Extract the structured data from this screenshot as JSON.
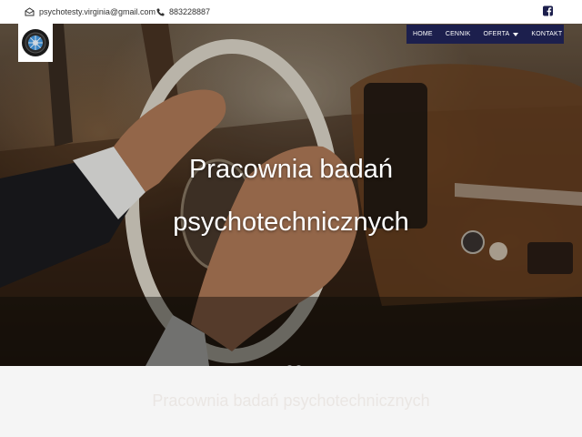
{
  "topbar": {
    "email": "psychotesty.virginia@gmail.com",
    "phone": "883228887"
  },
  "nav": {
    "items": [
      {
        "label": "HOME"
      },
      {
        "label": "CENNIK"
      },
      {
        "label": "OFERTA",
        "has_dropdown": true
      },
      {
        "label": "KONTAKT"
      }
    ]
  },
  "hero": {
    "title_line1": "Pracownia badań",
    "title_line2": "psychotechnicznych",
    "slides_count": 2,
    "active_slide": 1
  },
  "section": {
    "title": "Pracownia badań psychotechnicznych"
  },
  "colors": {
    "nav_bg": "#1c1f4d",
    "topbar_bg": "#ffffff",
    "facebook": "#1c1f4d"
  },
  "icons": {
    "email": "envelope-icon",
    "phone": "phone-icon",
    "social": "facebook-icon"
  }
}
